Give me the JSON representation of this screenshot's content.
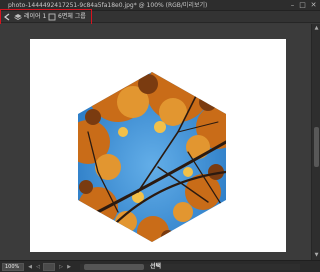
{
  "window": {
    "title": "photo-1444492417251-9c84a5fa18e0.jpg* @ 100% (RGB/미리보기)",
    "minimize_glyph": "–",
    "maximize_glyph": "□",
    "close_glyph": "✕"
  },
  "toolbar": {
    "back_icon": "back-arrow-icon",
    "layers_icon": "layers-icon",
    "layer_name": "레이어 1",
    "shape_label": "6면체 그룹"
  },
  "canvas": {
    "background": "#ffffff",
    "image_shape": "hexagon",
    "photo_subject": "autumn leaves against blue sky",
    "colors": {
      "sky": "#3e8fd6",
      "leaves_orange": "#d47a1e",
      "leaves_dark": "#6a3a12",
      "branches": "#2b1a10"
    }
  },
  "statusbar": {
    "zoom": "100%",
    "label": "선택"
  },
  "accents": {
    "highlight": "#d8141f"
  }
}
